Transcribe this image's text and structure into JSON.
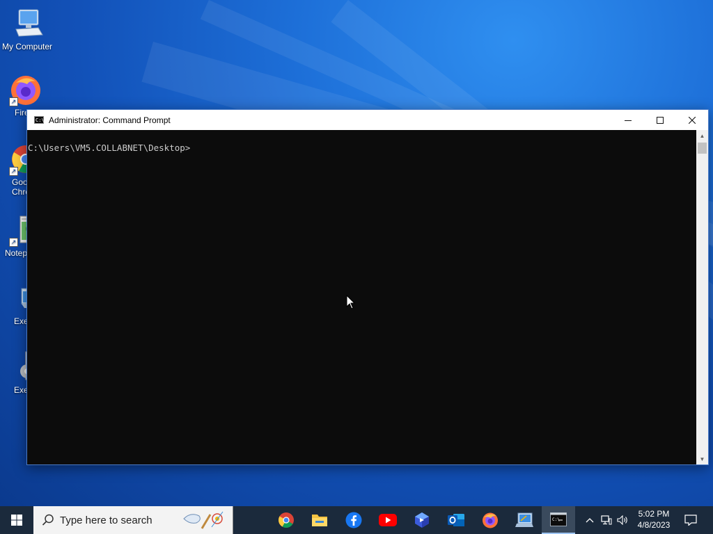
{
  "desktop": {
    "icons": [
      {
        "label": "My Computer",
        "icon": "computer-icon"
      },
      {
        "label": "Fire",
        "icon": "firefox-icon"
      },
      {
        "label": "Goo Chro",
        "icon": "chrome-icon"
      },
      {
        "label": "Notep",
        "icon": "notepad-icon"
      },
      {
        "label": "Exe",
        "icon": "executable-icon"
      },
      {
        "label": "Exe",
        "icon": "settings-executable-icon"
      }
    ]
  },
  "cmd_window": {
    "title": "Administrator:  Command Prompt",
    "console_text": "C:\\Users\\VM5.COLLABNET\\Desktop>",
    "buttons": {
      "minimize": "minimize-icon",
      "maximize": "maximize-icon",
      "close": "close-icon"
    }
  },
  "taskbar": {
    "search_placeholder": "Type here to search",
    "apps": [
      "chrome-icon",
      "file-explorer-icon",
      "facebook-icon",
      "youtube-icon",
      "power-automate-icon",
      "outlook-icon",
      "firefox-icon",
      "executable-icon",
      "command-prompt-icon"
    ],
    "active_app": "command-prompt-icon",
    "clock": {
      "time": "5:02 PM",
      "date": "4/8/2023"
    }
  },
  "colors": {
    "desktop_blue": "#1d6fd8",
    "taskbar": "#1b2a3c",
    "console_bg": "#0c0c0c",
    "console_text": "#cccccc"
  }
}
